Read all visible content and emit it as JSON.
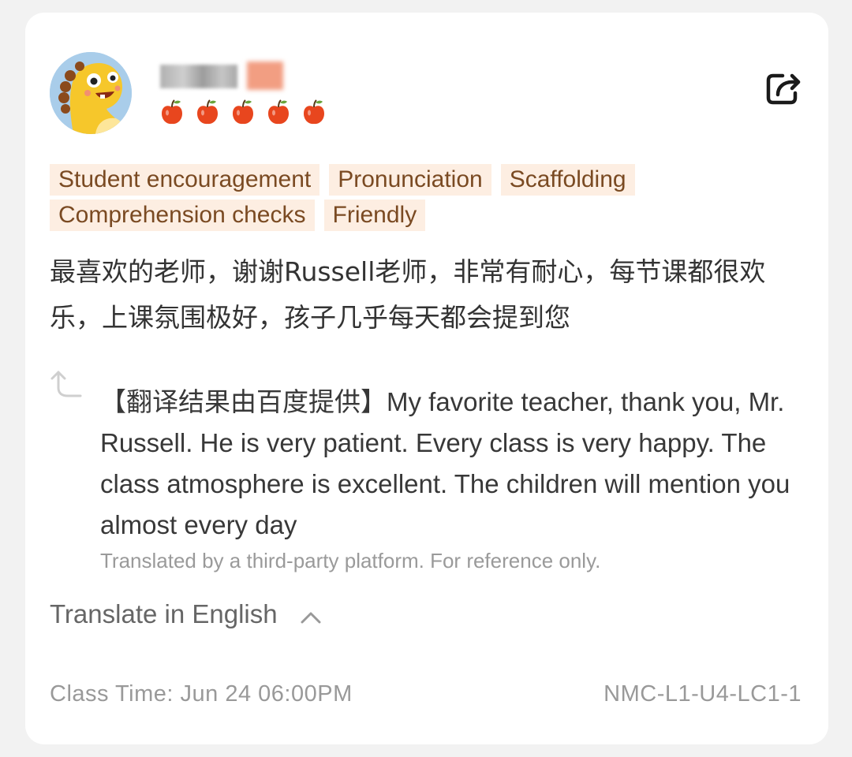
{
  "review_card": {
    "rating": {
      "value": 5,
      "max": 5,
      "icon": "apple-icon",
      "color": "#e8461e"
    },
    "tags": [
      "Student encouragement",
      "Pronunciation",
      "Scaffolding",
      "Comprehension checks",
      "Friendly"
    ],
    "review_text": "最喜欢的老师，谢谢Russell老师，非常有耐心，每节课都很欢乐，上课氛围极好，孩子几乎每天都会提到您",
    "translation": {
      "text": "【翻译结果由百度提供】My favorite teacher, thank you, Mr. Russell. He is very patient. Every class is very happy. The class atmosphere is excellent. The children will mention you almost every day",
      "disclaimer": "Translated by a third-party platform. For reference only."
    },
    "translate_toggle_label": "Translate in English",
    "class_time": "Class Time: Jun 24 06:00PM",
    "class_code": "NMC-L1-U4-LC1-1",
    "icons": {
      "share": "share-icon",
      "translate": "translate-arrow-icon",
      "collapse": "chevron-up-icon"
    },
    "colors": {
      "tag_background": "#fdeee2",
      "tag_text": "#7a4a22",
      "accent": "#e8461e"
    }
  }
}
